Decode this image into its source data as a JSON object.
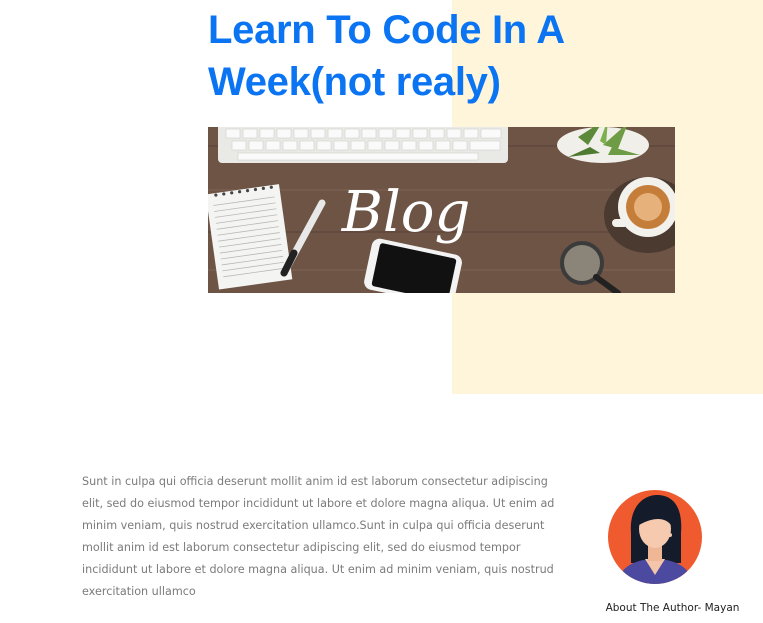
{
  "post": {
    "title": "Learn To Code In A Week(not realy)",
    "hero_image_text": "Blog",
    "body": "Sunt in culpa qui officia deserunt mollit anim id est laborum consectetur adipiscing elit, sed do eiusmod tempor incididunt ut labore et dolore magna aliqua. Ut enim ad minim veniam, quis nostrud exercitation ullamco.Sunt in culpa qui officia deserunt mollit anim id est laborum consectetur adipiscing elit, sed do eiusmod tempor incididunt ut labore et dolore magna aliqua. Ut enim ad minim veniam, quis nostrud exercitation ullamco"
  },
  "author": {
    "label": "About The Author- Mayan"
  },
  "colors": {
    "title": "#0a74f2",
    "accent_panel": "#fff5da",
    "body_text": "#7b7b7b",
    "avatar_bg": "#ef5a2e"
  }
}
